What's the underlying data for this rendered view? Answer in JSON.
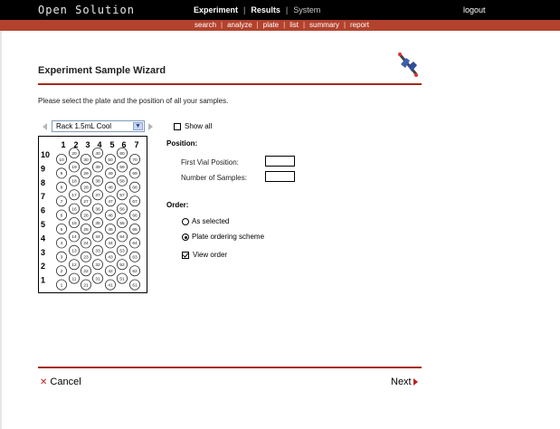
{
  "app": {
    "brand": "Open Solution",
    "logout": "logout"
  },
  "main_nav": [
    {
      "label": "Experiment",
      "style": "strong"
    },
    {
      "label": "Results",
      "style": "strong"
    },
    {
      "label": "System",
      "style": "dim"
    }
  ],
  "sub_nav": [
    "search",
    "analyze",
    "plate",
    "list",
    "summary",
    "report"
  ],
  "wizard": {
    "title": "Experiment Sample Wizard",
    "intro": "Please select the plate and the position of all your samples."
  },
  "rack": {
    "selected": "Rack 1.5mL Cool",
    "show_all_label": "Show all",
    "show_all_checked": false
  },
  "plate": {
    "col_headers": [
      "1",
      "2",
      "3",
      "4",
      "5",
      "6",
      "7"
    ],
    "row_labels": [
      "10",
      "9",
      "8",
      "7",
      "6",
      "5",
      "4",
      "3",
      "2",
      "1"
    ],
    "grid": [
      [
        "10",
        "20",
        "30",
        "40",
        "50",
        "60",
        "70"
      ],
      [
        "9",
        "19",
        "29",
        "39",
        "49",
        "59",
        "69"
      ],
      [
        "8",
        "18",
        "28",
        "38",
        "48",
        "58",
        "68"
      ],
      [
        "7",
        "17",
        "27",
        "37",
        "47",
        "57",
        "67"
      ],
      [
        "6",
        "16",
        "26",
        "36",
        "46",
        "56",
        "66"
      ],
      [
        "5",
        "15",
        "25",
        "35",
        "45",
        "55",
        "65"
      ],
      [
        "4",
        "14",
        "24",
        "34",
        "44",
        "54",
        "64"
      ],
      [
        "3",
        "13",
        "23",
        "33",
        "43",
        "53",
        "63"
      ],
      [
        "2",
        "12",
        "22",
        "32",
        "42",
        "52",
        "62"
      ],
      [
        "1",
        "11",
        "21",
        "31",
        "41",
        "51",
        "61"
      ]
    ]
  },
  "position": {
    "heading": "Position:",
    "first_vial_label": "First Vial Position:",
    "first_vial_value": "",
    "num_samples_label": "Number of Samples:",
    "num_samples_value": ""
  },
  "order": {
    "heading": "Order:",
    "as_selected": "As selected",
    "plate_scheme": "Plate ordering scheme",
    "selected": "plate_scheme",
    "view_order": "View order",
    "view_order_checked": true
  },
  "footer": {
    "cancel": "Cancel",
    "next": "Next"
  }
}
